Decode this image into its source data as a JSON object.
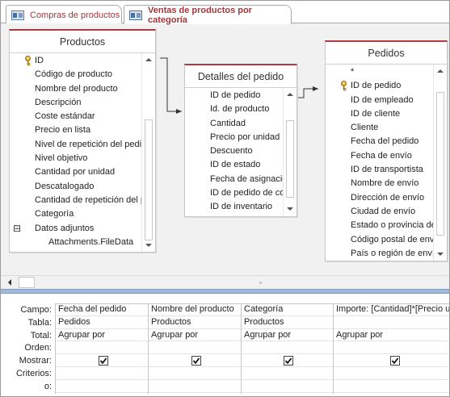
{
  "tabs": [
    {
      "label": "Compras de productos",
      "active": false
    },
    {
      "label": "Ventas de productos por categoría",
      "active": true
    }
  ],
  "tables": {
    "productos": {
      "title": "Productos",
      "fields": [
        {
          "name": "ID",
          "key": true
        },
        {
          "name": "Código de producto"
        },
        {
          "name": "Nombre del producto"
        },
        {
          "name": "Descripción"
        },
        {
          "name": "Coste estándar"
        },
        {
          "name": "Precio en lista"
        },
        {
          "name": "Nivel de repetición del pedido"
        },
        {
          "name": "Nivel objetivo"
        },
        {
          "name": "Cantidad por unidad"
        },
        {
          "name": "Descatalogado"
        },
        {
          "name": "Cantidad de repetición del pedido"
        },
        {
          "name": "Categoría"
        },
        {
          "name": "Datos adjuntos",
          "expander": "⊟"
        },
        {
          "name": "Attachments.FileData",
          "child": true
        }
      ]
    },
    "detalles": {
      "title": "Detalles del pedido",
      "fields": [
        {
          "name": "ID de pedido"
        },
        {
          "name": "Id. de producto"
        },
        {
          "name": "Cantidad"
        },
        {
          "name": "Precio por unidad"
        },
        {
          "name": "Descuento"
        },
        {
          "name": "ID de estado"
        },
        {
          "name": "Fecha de asignación"
        },
        {
          "name": "ID de pedido de compra"
        },
        {
          "name": "ID de inventario"
        }
      ]
    },
    "pedidos": {
      "title": "Pedidos",
      "fields": [
        {
          "name": "*"
        },
        {
          "name": "ID de pedido",
          "key": true
        },
        {
          "name": "ID de empleado"
        },
        {
          "name": "ID de cliente"
        },
        {
          "name": "Cliente"
        },
        {
          "name": "Fecha del pedido"
        },
        {
          "name": "Fecha de envío"
        },
        {
          "name": "ID de transportista"
        },
        {
          "name": "Nombre de envío"
        },
        {
          "name": "Dirección de envío"
        },
        {
          "name": "Ciudad de envío"
        },
        {
          "name": "Estado o provincia de envío"
        },
        {
          "name": "Código postal de envío"
        },
        {
          "name": "País o región de envío"
        }
      ]
    }
  },
  "grid": {
    "row_labels": [
      "Campo:",
      "Tabla:",
      "Total:",
      "Orden:",
      "Mostrar:",
      "Criterios:",
      "o:"
    ],
    "columns": [
      {
        "campo": "Fecha del pedido",
        "tabla": "Pedidos",
        "total": "Agrupar por",
        "orden": "",
        "mostrar": true,
        "criterios": "",
        "o": ""
      },
      {
        "campo": "Nombre del producto",
        "tabla": "Productos",
        "total": "Agrupar por",
        "orden": "",
        "mostrar": true,
        "criterios": "",
        "o": ""
      },
      {
        "campo": "Categoría",
        "tabla": "Productos",
        "total": "Agrupar por",
        "orden": "",
        "mostrar": true,
        "criterios": "",
        "o": ""
      },
      {
        "campo": "Importe: [Cantidad]*[Precio unitario]",
        "tabla": "",
        "total": "Agrupar por",
        "orden": "",
        "mostrar": true,
        "criterios": "",
        "o": ""
      }
    ]
  },
  "colors": {
    "accent": "#b03a3e",
    "tab_text": "#a4373a",
    "splitter": "#9fbad6",
    "design_bg": "#f1f1f1"
  },
  "icons": {
    "tab": "query-icon",
    "key": "primary-key-icon",
    "check": "checkmark-icon"
  }
}
